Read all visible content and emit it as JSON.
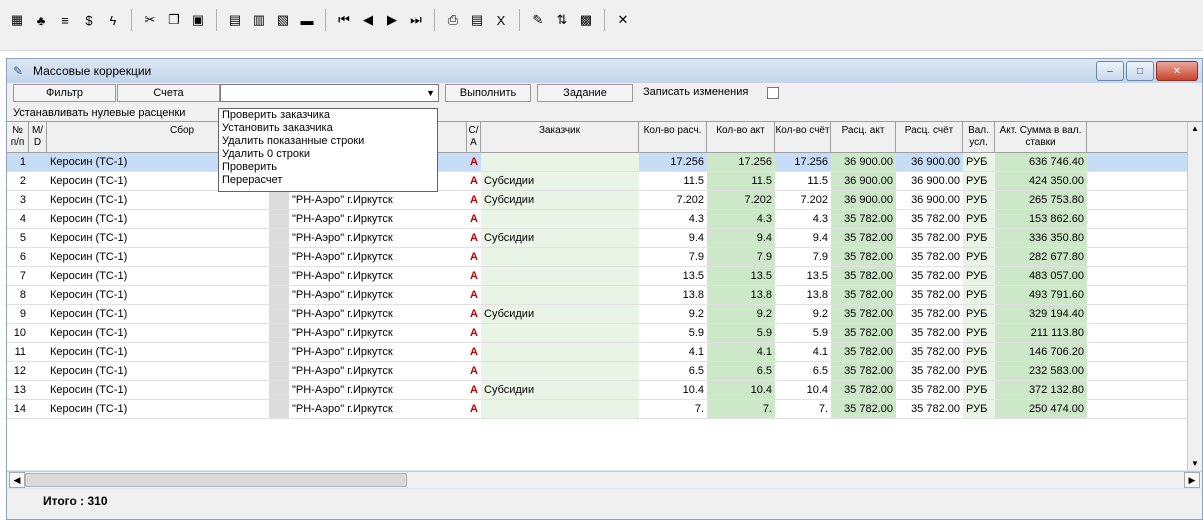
{
  "toolbar": {
    "icons": [
      {
        "name": "grid-view-icon",
        "glyph": "▦"
      },
      {
        "name": "tree-icon",
        "glyph": "♣"
      },
      {
        "name": "stack-icon",
        "glyph": "≡"
      },
      {
        "name": "dollar-icon",
        "glyph": "$"
      },
      {
        "name": "lightning-icon",
        "glyph": "ϟ"
      },
      {
        "name": "cut-icon",
        "glyph": "✂"
      },
      {
        "name": "copy-icon",
        "glyph": "❐"
      },
      {
        "name": "paste-icon",
        "glyph": "▣"
      },
      {
        "name": "window-icon",
        "glyph": "▤"
      },
      {
        "name": "save-icon",
        "glyph": "▥"
      },
      {
        "name": "network-icon",
        "glyph": "▧"
      },
      {
        "name": "remove-icon",
        "glyph": "▬"
      },
      {
        "name": "first-record-icon",
        "glyph": "⏮"
      },
      {
        "name": "previous-record-icon",
        "glyph": "◀"
      },
      {
        "name": "next-record-icon",
        "glyph": "▶"
      },
      {
        "name": "last-record-icon",
        "glyph": "⏭"
      },
      {
        "name": "print-icon",
        "glyph": "⎙"
      },
      {
        "name": "report-icon",
        "glyph": "▤"
      },
      {
        "name": "excel-icon",
        "glyph": "X"
      },
      {
        "name": "wand-icon",
        "glyph": "✎"
      },
      {
        "name": "sort-icon",
        "glyph": "⇅"
      },
      {
        "name": "calculator-icon",
        "glyph": "▩"
      },
      {
        "name": "close-icon",
        "glyph": "✕"
      }
    ]
  },
  "window": {
    "title": "Массовые коррекции",
    "buttons": {
      "minimize": "–",
      "maximize": "□",
      "close": "✕"
    }
  },
  "controls": {
    "filter": "Фильтр",
    "accounts": "Счета",
    "combo_value": "",
    "execute": "Выполнить",
    "task": "Задание",
    "record_changes": "Записать изменения",
    "zero_rates": "Устанавливать нулевые расценки"
  },
  "dropdown_items": [
    "Проверить заказчика",
    "Установить заказчика",
    "Удалить показанные строки",
    "Удалить 0 строки",
    "Проверить",
    "Перерасчет"
  ],
  "headers": {
    "num": "№ п/п",
    "md": "M/ D",
    "sbor": "Сбор",
    "ca": "C/ A",
    "customer": "Заказчик",
    "qty_calc": "Кол-во расч.",
    "qty_act": "Кол-во акт",
    "qty_acc": "Кол-во счёт",
    "rate_act": "Расц. акт",
    "rate_acc": "Расц. счёт",
    "cur": "Вал. усл.",
    "sum": "Акт. Сумма в вал. ставки"
  },
  "rows": [
    {
      "n": "1",
      "sbor": "Керосин (ТС-1)",
      "org": "",
      "ca": "A",
      "cust": "",
      "q1": "17.256",
      "q2": "17.256",
      "q3": "17.256",
      "r1": "36 900.00",
      "r2": "36 900.00",
      "cur": "РУБ",
      "sum": "636 746.40"
    },
    {
      "n": "2",
      "sbor": "Керосин (ТС-1)",
      "org": "\"РН-Аэро\" г.Иркутск",
      "ca": "A",
      "cust": "Субсидии",
      "q1": "11.5",
      "q2": "11.5",
      "q3": "11.5",
      "r1": "36 900.00",
      "r2": "36 900.00",
      "cur": "РУБ",
      "sum": "424 350.00"
    },
    {
      "n": "3",
      "sbor": "Керосин (ТС-1)",
      "org": "\"РН-Аэро\" г.Иркутск",
      "ca": "A",
      "cust": "Субсидии",
      "q1": "7.202",
      "q2": "7.202",
      "q3": "7.202",
      "r1": "36 900.00",
      "r2": "36 900.00",
      "cur": "РУБ",
      "sum": "265 753.80"
    },
    {
      "n": "4",
      "sbor": "Керосин (ТС-1)",
      "org": "\"РН-Аэро\" г.Иркутск",
      "ca": "A",
      "cust": "",
      "q1": "4.3",
      "q2": "4.3",
      "q3": "4.3",
      "r1": "35 782.00",
      "r2": "35 782.00",
      "cur": "РУБ",
      "sum": "153 862.60"
    },
    {
      "n": "5",
      "sbor": "Керосин (ТС-1)",
      "org": "\"РН-Аэро\" г.Иркутск",
      "ca": "A",
      "cust": "Субсидии",
      "q1": "9.4",
      "q2": "9.4",
      "q3": "9.4",
      "r1": "35 782.00",
      "r2": "35 782.00",
      "cur": "РУБ",
      "sum": "336 350.80"
    },
    {
      "n": "6",
      "sbor": "Керосин (ТС-1)",
      "org": "\"РН-Аэро\" г.Иркутск",
      "ca": "A",
      "cust": "",
      "q1": "7.9",
      "q2": "7.9",
      "q3": "7.9",
      "r1": "35 782.00",
      "r2": "35 782.00",
      "cur": "РУБ",
      "sum": "282 677.80"
    },
    {
      "n": "7",
      "sbor": "Керосин (ТС-1)",
      "org": "\"РН-Аэро\" г.Иркутск",
      "ca": "A",
      "cust": "",
      "q1": "13.5",
      "q2": "13.5",
      "q3": "13.5",
      "r1": "35 782.00",
      "r2": "35 782.00",
      "cur": "РУБ",
      "sum": "483 057.00"
    },
    {
      "n": "8",
      "sbor": "Керосин (ТС-1)",
      "org": "\"РН-Аэро\" г.Иркутск",
      "ca": "A",
      "cust": "",
      "q1": "13.8",
      "q2": "13.8",
      "q3": "13.8",
      "r1": "35 782.00",
      "r2": "35 782.00",
      "cur": "РУБ",
      "sum": "493 791.60"
    },
    {
      "n": "9",
      "sbor": "Керосин (ТС-1)",
      "org": "\"РН-Аэро\" г.Иркутск",
      "ca": "A",
      "cust": "Субсидии",
      "q1": "9.2",
      "q2": "9.2",
      "q3": "9.2",
      "r1": "35 782.00",
      "r2": "35 782.00",
      "cur": "РУБ",
      "sum": "329 194.40"
    },
    {
      "n": "10",
      "sbor": "Керосин (ТС-1)",
      "org": "\"РН-Аэро\" г.Иркутск",
      "ca": "A",
      "cust": "",
      "q1": "5.9",
      "q2": "5.9",
      "q3": "5.9",
      "r1": "35 782.00",
      "r2": "35 782.00",
      "cur": "РУБ",
      "sum": "211 113.80"
    },
    {
      "n": "11",
      "sbor": "Керосин (ТС-1)",
      "org": "\"РН-Аэро\" г.Иркутск",
      "ca": "A",
      "cust": "",
      "q1": "4.1",
      "q2": "4.1",
      "q3": "4.1",
      "r1": "35 782.00",
      "r2": "35 782.00",
      "cur": "РУБ",
      "sum": "146 706.20"
    },
    {
      "n": "12",
      "sbor": "Керосин (ТС-1)",
      "org": "\"РН-Аэро\" г.Иркутск",
      "ca": "A",
      "cust": "",
      "q1": "6.5",
      "q2": "6.5",
      "q3": "6.5",
      "r1": "35 782.00",
      "r2": "35 782.00",
      "cur": "РУБ",
      "sum": "232 583.00"
    },
    {
      "n": "13",
      "sbor": "Керосин (ТС-1)",
      "org": "\"РН-Аэро\" г.Иркутск",
      "ca": "A",
      "cust": "Субсидии",
      "q1": "10.4",
      "q2": "10.4",
      "q3": "10.4",
      "r1": "35 782.00",
      "r2": "35 782.00",
      "cur": "РУБ",
      "sum": "372 132.80"
    },
    {
      "n": "14",
      "sbor": "Керосин (ТС-1)",
      "org": "\"РН-Аэро\" г.Иркутск",
      "ca": "A",
      "cust": "",
      "q1": "7.",
      "q2": "7.",
      "q3": "7.",
      "r1": "35 782.00",
      "r2": "35 782.00",
      "cur": "РУБ",
      "sum": "250 474.00"
    }
  ],
  "footer": {
    "total": "Итого : 310"
  }
}
